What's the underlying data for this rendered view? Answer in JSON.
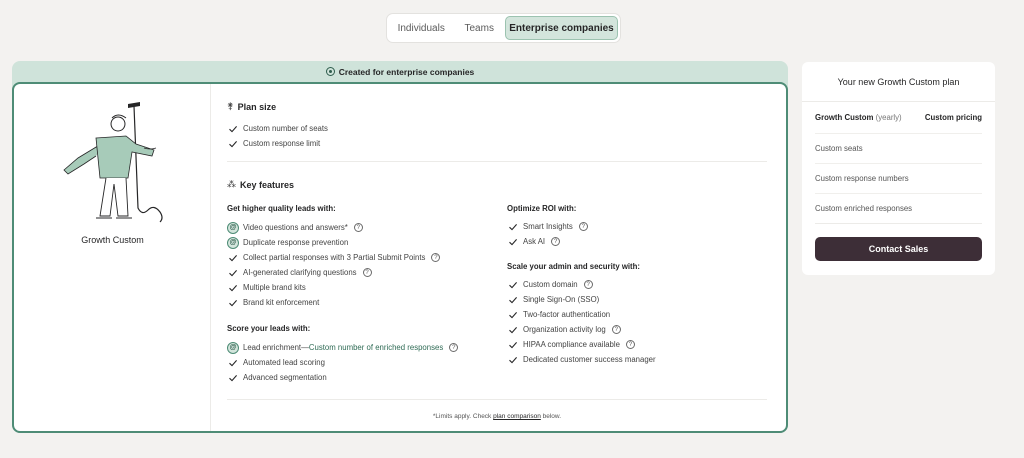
{
  "tabs": [
    {
      "label": "Individuals",
      "active": false
    },
    {
      "label": "Teams",
      "active": false
    },
    {
      "label": "Enterprise companies",
      "active": true
    }
  ],
  "banner": {
    "title": "Created for enterprise companies",
    "icon": "ai-sparkle-icon"
  },
  "plan": {
    "name": "Growth Custom"
  },
  "plan_size": {
    "heading": "Plan size",
    "icon": "tag-icon",
    "items": [
      "Custom number of seats",
      "Custom response limit"
    ]
  },
  "key_features": {
    "heading": "Key features",
    "icon": "nodes-icon",
    "groups": {
      "leads": {
        "title": "Get higher quality leads with:",
        "items": [
          {
            "text": "Video questions and answers*",
            "icon": "ai",
            "help": true
          },
          {
            "text": "Duplicate response prevention",
            "icon": "ai",
            "help": false
          },
          {
            "text": "Collect partial responses with 3 Partial Submit Points",
            "icon": "check",
            "help": true
          },
          {
            "text": "AI-generated clarifying questions",
            "icon": "check",
            "help": true
          },
          {
            "text": "Multiple brand kits",
            "icon": "check",
            "help": false
          },
          {
            "text": "Brand kit enforcement",
            "icon": "check",
            "help": false
          }
        ]
      },
      "score": {
        "title": "Score your leads with:",
        "items": [
          {
            "text": "Lead enrichment—",
            "link": "Custom number of enriched responses",
            "icon": "ai",
            "help": true
          },
          {
            "text": "Automated lead scoring",
            "icon": "check",
            "help": false
          },
          {
            "text": "Advanced segmentation",
            "icon": "check",
            "help": false
          }
        ]
      },
      "roi": {
        "title": "Optimize ROI with:",
        "items": [
          {
            "text": "Smart Insights",
            "icon": "check",
            "help": true
          },
          {
            "text": "Ask AI",
            "icon": "check",
            "help": true
          }
        ]
      },
      "admin": {
        "title": "Scale your admin and security with:",
        "items": [
          {
            "text": "Custom domain",
            "icon": "check",
            "help": true
          },
          {
            "text": "Single Sign-On (SSO)",
            "icon": "check",
            "help": false
          },
          {
            "text": "Two-factor authentication",
            "icon": "check",
            "help": false
          },
          {
            "text": "Organization activity log",
            "icon": "check",
            "help": true
          },
          {
            "text": "HIPAA compliance available",
            "icon": "check",
            "help": true
          },
          {
            "text": "Dedicated customer success manager",
            "icon": "check",
            "help": false
          }
        ]
      }
    }
  },
  "footnote": {
    "prefix": "*Limits apply. Check ",
    "link": "plan comparison",
    "suffix": " below."
  },
  "panel": {
    "title": "Your new Growth Custom plan",
    "plan_label": "Growth Custom",
    "plan_period": "(yearly)",
    "plan_price": "Custom pricing",
    "rows": [
      "Custom seats",
      "Custom response numbers",
      "Custom enriched responses"
    ],
    "cta": "Contact Sales"
  },
  "colors": {
    "accent": "#4e8c76",
    "accent_bg": "#cfe3da",
    "cta": "#3d2e37",
    "background": "#f3f2f0"
  }
}
